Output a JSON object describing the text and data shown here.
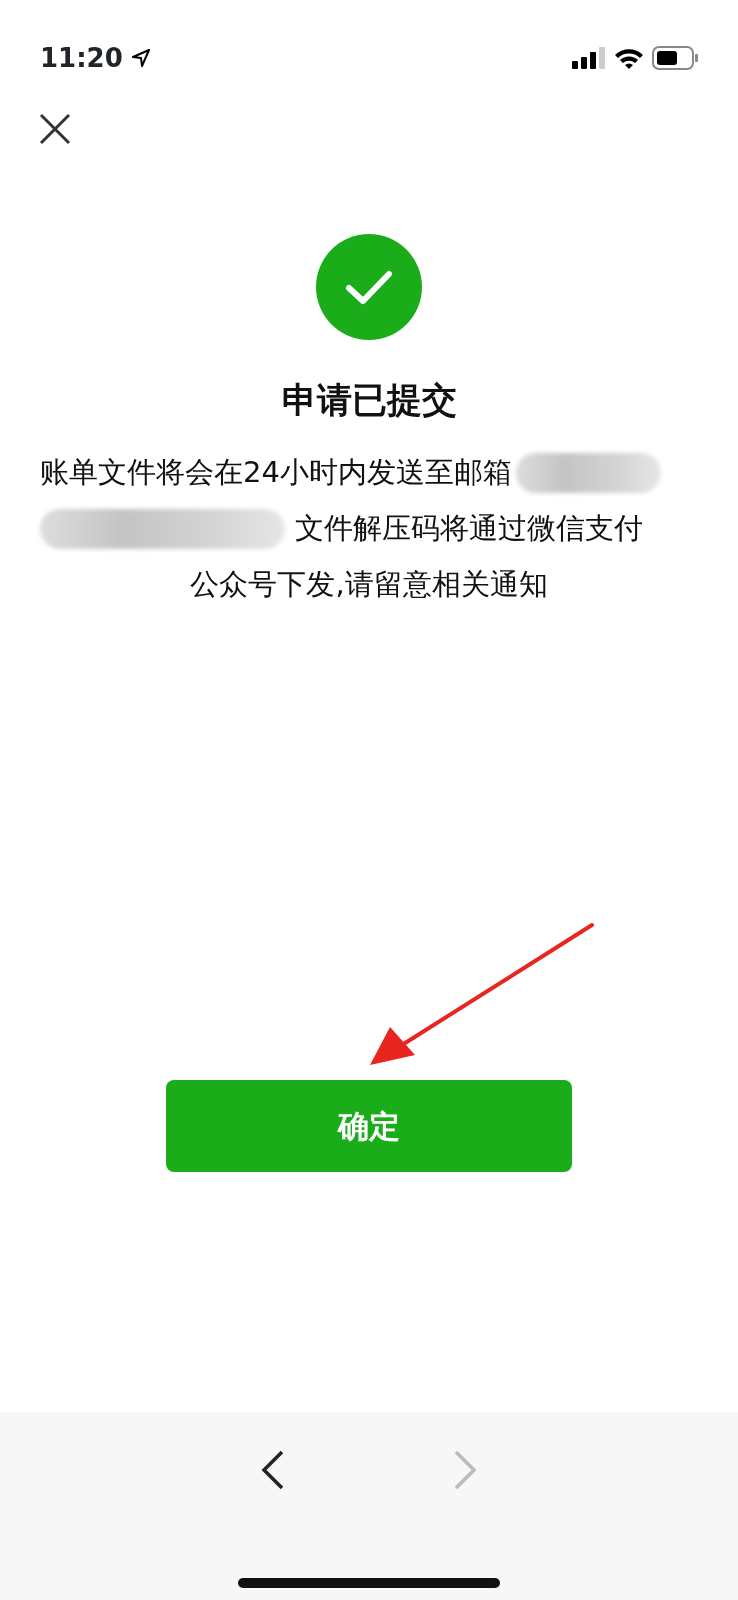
{
  "status_bar": {
    "time": "11:20"
  },
  "title": "申请已提交",
  "message_lines": [
    {
      "segments": [
        {
          "kind": "text",
          "text": "账单文件将会在24小时内发送至邮箱"
        },
        {
          "kind": "redaction"
        }
      ]
    },
    {
      "segments": [
        {
          "kind": "redaction"
        },
        {
          "kind": "text",
          "text": "文件解压码将通过微信支付"
        }
      ]
    },
    {
      "segments": [
        {
          "kind": "text",
          "text": "公众号下发,请留意相关通知"
        }
      ]
    }
  ],
  "annotation": {
    "kind": "arrow"
  },
  "button": {
    "label": "确定"
  },
  "toolbar": [
    {
      "kind": "back",
      "disabled": false
    },
    {
      "kind": "forward",
      "disabled": true
    }
  ]
}
